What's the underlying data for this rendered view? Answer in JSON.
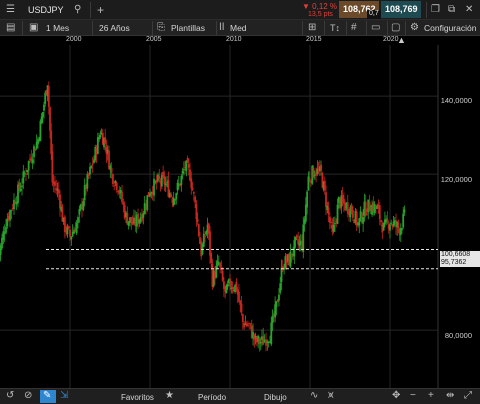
{
  "topbar": {
    "symbol": "USDJPY",
    "add_icon": "plus-icon",
    "change_pct": "▼ 0,12 %",
    "change_pts": "13,5 pts",
    "bid": "108,762",
    "spread": "0,7",
    "ask": "108,769"
  },
  "toolbar": {
    "interval": "1 Mes",
    "range": "26 Años",
    "templates": "Plantillas",
    "chart_type": "Med",
    "settings": "Configuración"
  },
  "axis": {
    "x_labels": [
      "2000",
      "2005",
      "2010",
      "2015",
      "2020"
    ],
    "y_labels": [
      "140,0000",
      "120,0000",
      "80,0000"
    ],
    "price_tags": [
      "100,6608",
      "95,7362"
    ]
  },
  "bottombar": {
    "favorites": "Favoritos",
    "period": "Período",
    "drawing": "Dibujo"
  },
  "colors": {
    "up": "#27a52b",
    "down": "#c7271f",
    "tag_bg": "#e6e6e6",
    "bid_bg": "#6b4a2a",
    "ask_bg": "#1e4a52",
    "accent_blue": "#2f86d0",
    "change_red": "#e0403a"
  },
  "chart_data": {
    "type": "candlestick",
    "y_ticks": [
      140,
      120,
      80
    ],
    "x_ticks": [
      2000,
      2005,
      2010,
      2015,
      2020
    ],
    "horizontal_lines": [
      100.6608,
      95.7362
    ],
    "series": [
      {
        "values": [
          [
            1995.5,
            98
          ],
          [
            1996.0,
            108
          ],
          [
            1996.5,
            113
          ],
          [
            1997.0,
            118
          ],
          [
            1997.5,
            124
          ],
          [
            1998.0,
            129
          ],
          [
            1998.3,
            136
          ],
          [
            1998.6,
            144
          ],
          [
            1998.9,
            118
          ],
          [
            1999.3,
            115
          ],
          [
            1999.6,
            107
          ],
          [
            2000.0,
            104
          ],
          [
            2000.5,
            108
          ],
          [
            2001.0,
            117
          ],
          [
            2001.5,
            124
          ],
          [
            2001.9,
            131
          ],
          [
            2002.2,
            128
          ],
          [
            2002.6,
            120
          ],
          [
            2003.0,
            117
          ],
          [
            2003.5,
            109
          ],
          [
            2004.0,
            107
          ],
          [
            2004.5,
            110
          ],
          [
            2005.0,
            116
          ],
          [
            2005.5,
            118
          ],
          [
            2005.9,
            118
          ],
          [
            2006.4,
            114
          ],
          [
            2006.8,
            117
          ],
          [
            2007.2,
            122
          ],
          [
            2007.5,
            120
          ],
          [
            2007.9,
            110
          ],
          [
            2008.2,
            100
          ],
          [
            2008.6,
            107
          ],
          [
            2008.9,
            93
          ],
          [
            2009.3,
            97
          ],
          [
            2009.7,
            89
          ],
          [
            2010.0,
            92
          ],
          [
            2010.4,
            91
          ],
          [
            2010.8,
            82
          ],
          [
            2011.2,
            81
          ],
          [
            2011.6,
            77
          ],
          [
            2012.0,
            77
          ],
          [
            2012.5,
            79
          ],
          [
            2012.9,
            86
          ],
          [
            2013.3,
            97
          ],
          [
            2013.7,
            98
          ],
          [
            2014.1,
            102
          ],
          [
            2014.5,
            102
          ],
          [
            2014.9,
            119
          ],
          [
            2015.3,
            121
          ],
          [
            2015.7,
            120
          ],
          [
            2016.0,
            113
          ],
          [
            2016.4,
            104
          ],
          [
            2016.8,
            113
          ],
          [
            2017.2,
            112
          ],
          [
            2017.6,
            111
          ],
          [
            2018.0,
            107
          ],
          [
            2018.4,
            111
          ],
          [
            2018.8,
            112
          ],
          [
            2019.2,
            111
          ],
          [
            2019.6,
            106
          ],
          [
            2020.0,
            108
          ],
          [
            2020.3,
            107
          ],
          [
            2020.6,
            106
          ],
          [
            2020.9,
            109
          ]
        ]
      }
    ]
  }
}
